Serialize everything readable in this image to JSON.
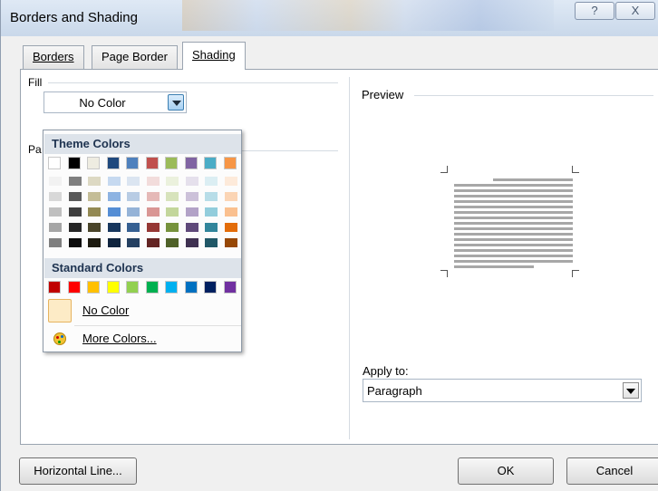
{
  "window": {
    "title": "Borders and Shading",
    "help_label": "?",
    "close_label": "X"
  },
  "tabs": [
    {
      "label": "Borders",
      "active": false
    },
    {
      "label": "Page Border",
      "active": false
    },
    {
      "label": "Shading",
      "active": true
    }
  ],
  "fill": {
    "label": "Fill",
    "value": "No Color"
  },
  "patterns": {
    "label_partial": "Pa"
  },
  "preview": {
    "label": "Preview"
  },
  "apply_to": {
    "label": "Apply to:",
    "value": "Paragraph"
  },
  "buttons": {
    "horizontal_line": "Horizontal Line...",
    "ok": "OK",
    "cancel": "Cancel"
  },
  "color_menu": {
    "theme_header": "Theme Colors",
    "standard_header": "Standard Colors",
    "no_color": "No Color",
    "more_colors": "More Colors...",
    "theme_top": [
      "#ffffff",
      "#000000",
      "#eeece1",
      "#1f497d",
      "#4f81bd",
      "#c0504d",
      "#9bbb59",
      "#8064a2",
      "#4bacc6",
      "#f79646"
    ],
    "theme_shades": [
      [
        "#f2f2f2",
        "#7f7f7f",
        "#ddd9c3",
        "#c6d9f0",
        "#dbe5f1",
        "#f2dcdb",
        "#ebf1dd",
        "#e5e0ec",
        "#dbeef3",
        "#fdeada"
      ],
      [
        "#d8d8d8",
        "#595959",
        "#c4bd97",
        "#8db3e2",
        "#b8cce4",
        "#e5b9b7",
        "#d7e3bc",
        "#ccc1d9",
        "#b7dde8",
        "#fbd5b5"
      ],
      [
        "#bfbfbf",
        "#3f3f3f",
        "#938953",
        "#548dd4",
        "#95b3d7",
        "#d99694",
        "#c3d69b",
        "#b2a2c7",
        "#92cddc",
        "#fac08f"
      ],
      [
        "#a5a5a5",
        "#262626",
        "#494429",
        "#17365d",
        "#366092",
        "#953734",
        "#76923c",
        "#5f497a",
        "#31859b",
        "#e36c09"
      ],
      [
        "#7f7f7f",
        "#0c0c0c",
        "#1d1b10",
        "#0f243e",
        "#244061",
        "#632423",
        "#4f6128",
        "#3f3151",
        "#205867",
        "#974806"
      ]
    ],
    "standard": [
      "#c00000",
      "#ff0000",
      "#ffc000",
      "#ffff00",
      "#92d050",
      "#00b050",
      "#00b0f0",
      "#0070c0",
      "#002060",
      "#7030a0"
    ]
  }
}
